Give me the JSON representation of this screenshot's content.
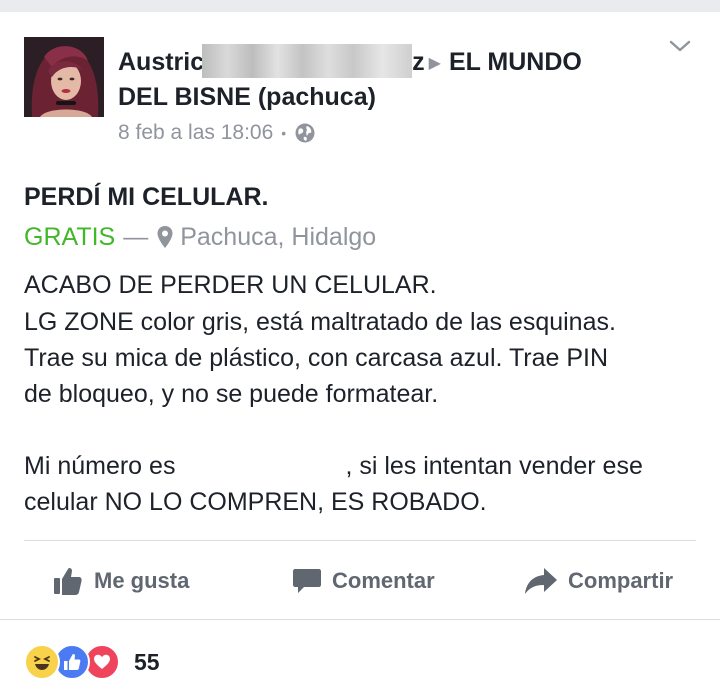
{
  "post": {
    "author_visible_start": "Austric",
    "author_visible_end": "z",
    "group_line1": "EL MUNDO",
    "group_line2": "DEL BISNE (pachuca)",
    "timestamp": "8 feb a las 18:06",
    "separator": "•",
    "privacy_icon": "globe-icon",
    "menu_icon": "chevron-down-icon"
  },
  "listing": {
    "title": "PERDÍ MI CELULAR.",
    "price": "GRATIS",
    "dash": "—",
    "location": "Pachuca, Hidalgo",
    "location_icon": "map-pin-icon"
  },
  "body": {
    "line1": "ACABO DE PERDER UN CELULAR.",
    "line2": "LG ZONE color gris, está maltratado de las esquinas.",
    "line3": "Trae su mica de plástico, con carcasa azul. Trae PIN",
    "line4": "de bloqueo, y no se puede formatear.",
    "line5_a": "Mi número es",
    "line5_b": ", si les intentan vender ese",
    "line6": "celular NO LO COMPREN, ES ROBADO."
  },
  "actions": {
    "like": "Me gusta",
    "comment": "Comentar",
    "share": "Compartir"
  },
  "reactions": {
    "icons": [
      "haha-reaction-icon",
      "like-reaction-icon",
      "love-reaction-icon"
    ],
    "count": "55"
  },
  "colors": {
    "price": "#42b72a",
    "secondary_text": "#90949c",
    "action_text": "#606770",
    "like_blue": "#4b7bf3",
    "love_red": "#f0445d",
    "haha_yellow": "#f7d24a"
  }
}
